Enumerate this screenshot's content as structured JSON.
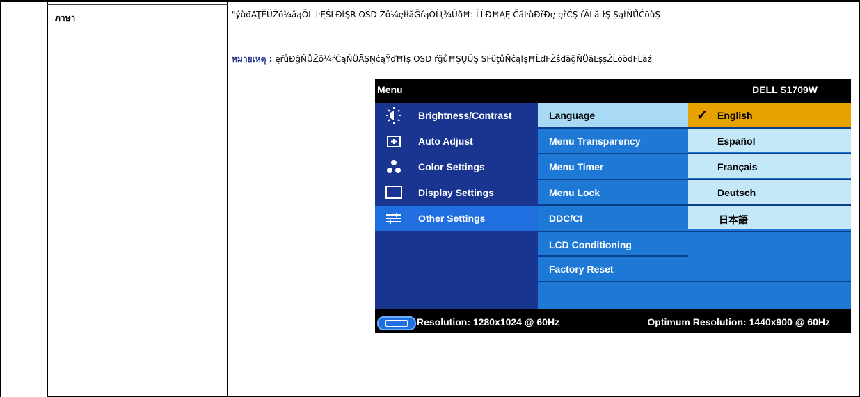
{
  "row": {
    "label": "ภาษา",
    "description": "\"ýůđĂŢĔŬŽŏ¼ăąŎĹ ĿĘŚĹĐŀŞŔ OSD Žŏ¼ęŀłăĞřąŎĹţ¾ŰðĦ: ĹĹĐĦĄĘ ČăĿůĐřĐę ęřĆŞ ŕĂĹă-ŀŞ ŞąŀŇŮĆŏůŞ",
    "note_label": "หมายเหตุ :",
    "note_text": "ęŕůĐĝŇŮŽŏ¼ŕĆąŇŮĂŞŅĉąŸďĦŀş OSD ŕğůĦŞŲŰŞ ŚFŭţůŇĉąŀşĦĹďFŹŝďăǧŇŮăĿşşŽĹŏŏdFĹăź"
  },
  "osd": {
    "title": "Menu",
    "model": "DELL S1709W",
    "left_menu": [
      {
        "label": "Brightness/Contrast",
        "icon": "brightness-icon"
      },
      {
        "label": "Auto Adjust",
        "icon": "auto-adjust-icon"
      },
      {
        "label": "Color Settings",
        "icon": "color-settings-icon"
      },
      {
        "label": "Display Settings",
        "icon": "display-settings-icon"
      },
      {
        "label": "Other Settings",
        "icon": "other-settings-icon"
      }
    ],
    "mid_menu": [
      {
        "label": "Language"
      },
      {
        "label": "Menu Transparency"
      },
      {
        "label": "Menu Timer"
      },
      {
        "label": "Menu Lock"
      },
      {
        "label": "DDC/CI"
      },
      {
        "label": "LCD Conditioning"
      },
      {
        "label": "Factory Reset"
      }
    ],
    "languages": [
      {
        "label": "English"
      },
      {
        "label": "Español"
      },
      {
        "label": "Français"
      },
      {
        "label": "Deutsch"
      },
      {
        "label": "日本語"
      }
    ],
    "resolution": "Resolution: 1280x1024 @ 60Hz",
    "optimum": "Optimum Resolution: 1440x900 @ 60Hz"
  },
  "colors": {
    "left_panel": "#19358f",
    "selected": "#1f6fe0",
    "mid_panel": "#1e78d6",
    "active_item": "#a8daf5",
    "language_bg": "#c4e8f8",
    "language_selected": "#e6a200"
  }
}
